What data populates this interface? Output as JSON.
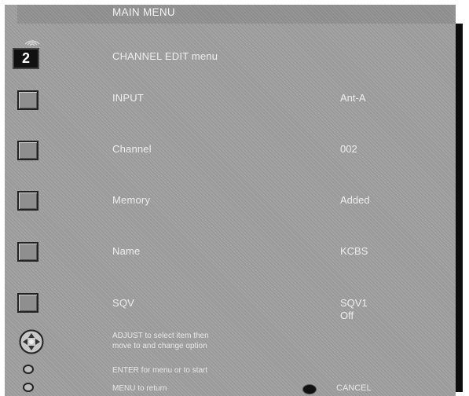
{
  "window": {
    "title": "MAIN MENU"
  },
  "channel_indicator": {
    "number": "2"
  },
  "menu": {
    "heading": "CHANNEL EDIT menu",
    "items": [
      {
        "label": "INPUT",
        "value": "Ant-A"
      },
      {
        "label": "Channel",
        "value": "002"
      },
      {
        "label": "Memory",
        "value": "Added"
      },
      {
        "label": "Name",
        "value": "KCBS"
      },
      {
        "label": "SQV",
        "value": "SQV1",
        "value2": "Off"
      }
    ]
  },
  "instructions": {
    "adjust_line1": "ADJUST to select item then",
    "adjust_line2": "move to and change option",
    "enter_line": "ENTER for menu or to start",
    "menu_line": "MENU to return",
    "cancel_label": "CANCEL"
  },
  "icons": {
    "signal": "signal-waves-icon",
    "dpad": "directional-pad-icon",
    "enter": "enter-button-icon",
    "menu": "menu-button-icon",
    "cancel": "cancel-button-icon"
  }
}
